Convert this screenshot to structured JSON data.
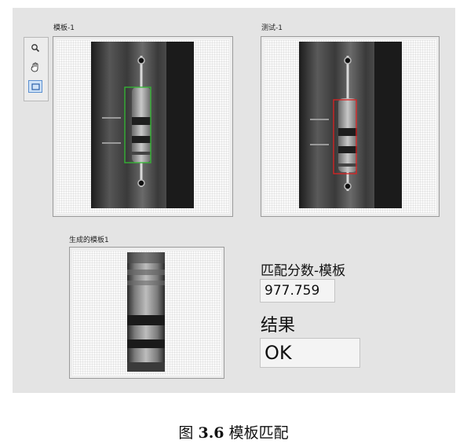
{
  "template_view": {
    "title": "模板-1"
  },
  "test_view": {
    "title": "测试-1"
  },
  "generated_view": {
    "title": "生成的模板1"
  },
  "toolbar": {
    "tools": [
      "zoom-icon",
      "pan-hand-icon",
      "rectangle-roi-icon"
    ],
    "active_tool": "rectangle-roi-icon"
  },
  "score": {
    "label": "匹配分数-模板",
    "value": "977.759"
  },
  "result": {
    "label": "结果",
    "value": "OK"
  },
  "figure_caption": {
    "prefix": "图 ",
    "number": "3.6",
    "text": " 模板匹配"
  },
  "colors": {
    "template_roi": "#33bb33",
    "match_roi": "#dd2222",
    "panel_bg": "#e4e4e4"
  }
}
